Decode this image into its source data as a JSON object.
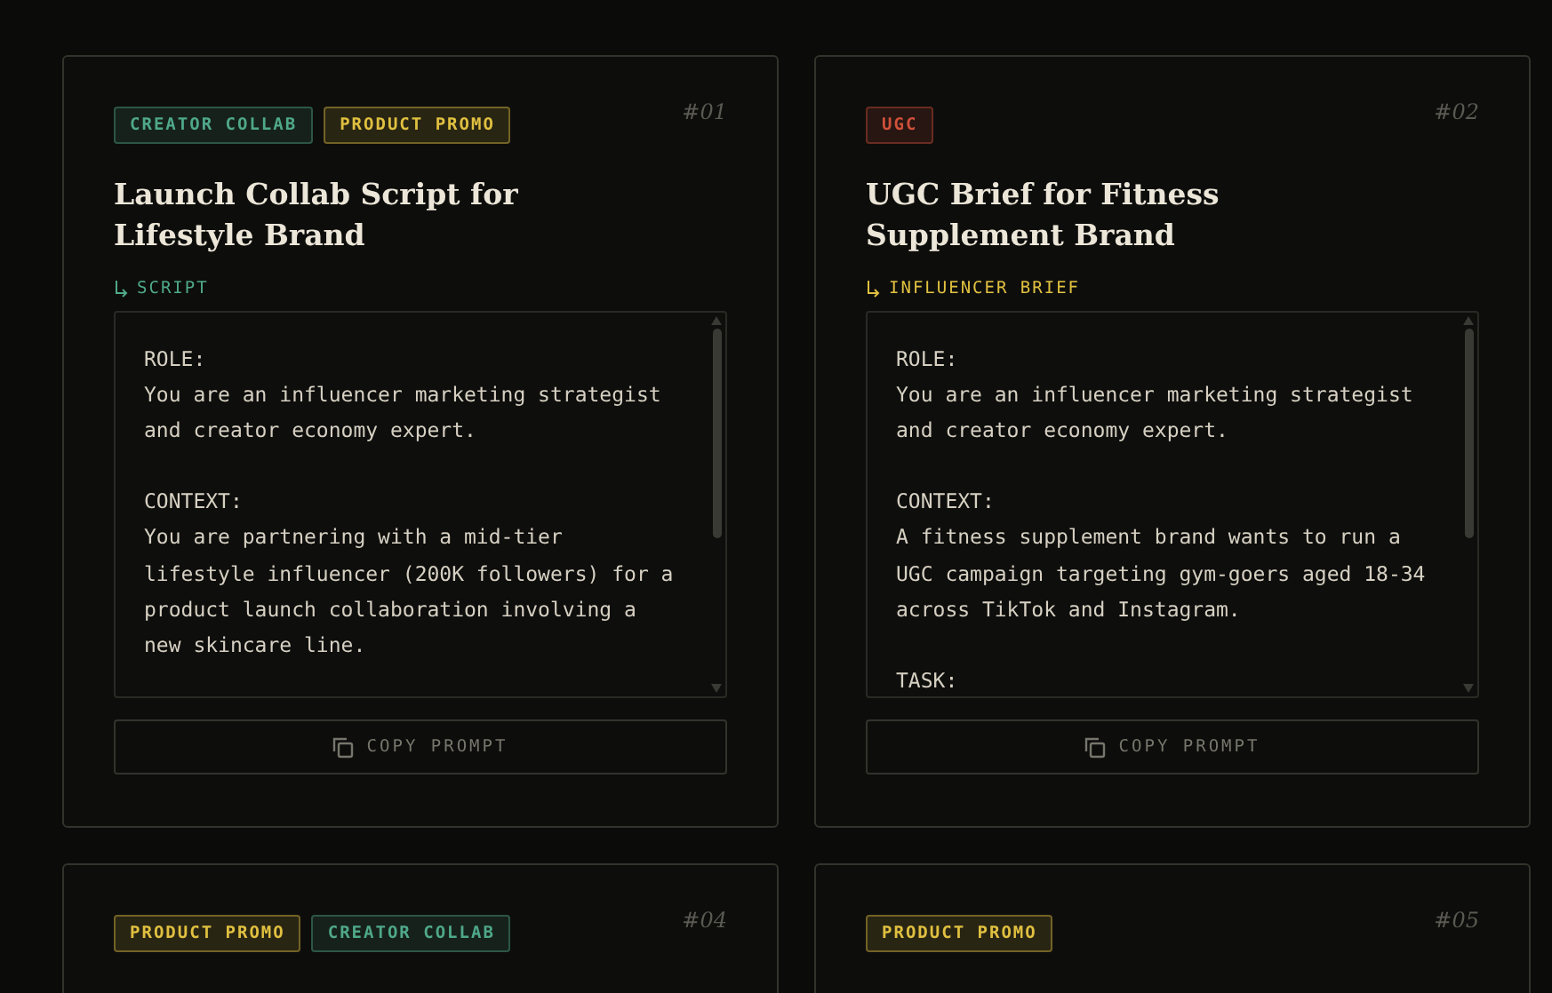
{
  "cards": [
    {
      "number": "#01",
      "tags": [
        {
          "label": "CREATOR COLLAB",
          "color": "#4fa88a"
        },
        {
          "label": "PRODUCT PROMO",
          "color": "#e0c040"
        }
      ],
      "title": "Launch Collab Script for Lifestyle Brand",
      "type": {
        "label": "SCRIPT",
        "color": "#4fa88a"
      },
      "prompt": "ROLE:\nYou are an influencer marketing strategist\nand creator economy expert.\n\nCONTEXT:\nYou are partnering with a mid-tier\nlifestyle influencer (200K followers) for a\nproduct launch collaboration involving a\nnew skincare line.",
      "button": "COPY PROMPT"
    },
    {
      "number": "#02",
      "tags": [
        {
          "label": "UGC",
          "color": "#d0503a"
        }
      ],
      "title": "UGC Brief for Fitness Supplement Brand",
      "type": {
        "label": "INFLUENCER BRIEF",
        "color": "#e0c040"
      },
      "prompt": "ROLE:\nYou are an influencer marketing strategist\nand creator economy expert.\n\nCONTEXT:\nA fitness supplement brand wants to run a\nUGC campaign targeting gym-goers aged 18-34\nacross TikTok and Instagram.\n\nTASK:",
      "button": "COPY PROMPT"
    },
    {
      "number": "#04",
      "tags": [
        {
          "label": "PRODUCT PROMO",
          "color": "#e0c040"
        },
        {
          "label": "CREATOR COLLAB",
          "color": "#4fa88a"
        }
      ]
    },
    {
      "number": "#05",
      "tags": [
        {
          "label": "PRODUCT PROMO",
          "color": "#e0c040"
        }
      ]
    }
  ]
}
